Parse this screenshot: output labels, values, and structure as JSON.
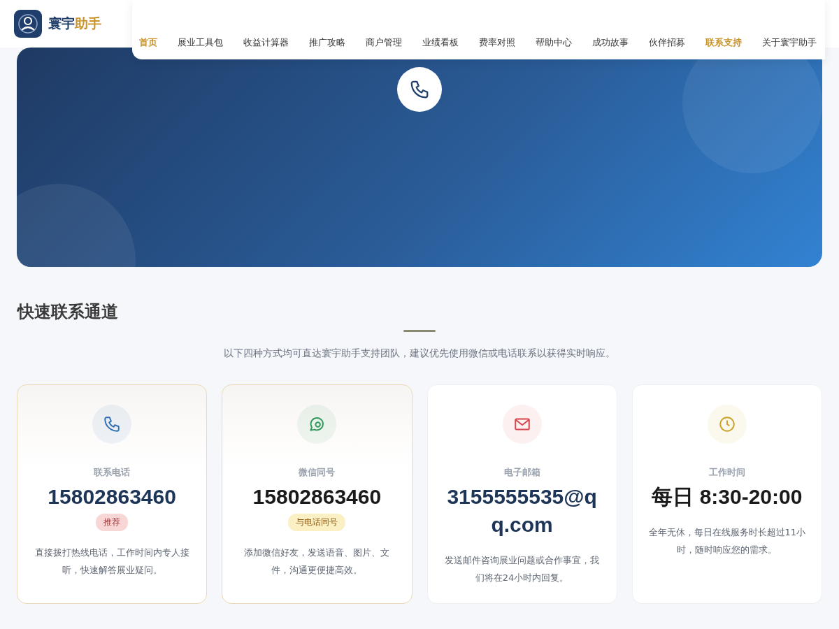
{
  "brand": {
    "name_part1": "寰宇",
    "name_part2": "助手"
  },
  "nav": [
    {
      "label": "首页",
      "selected": true
    },
    {
      "label": "展业工具包",
      "selected": false
    },
    {
      "label": "收益计算器",
      "selected": false
    },
    {
      "label": "推广攻略",
      "selected": false
    },
    {
      "label": "商户管理",
      "selected": false
    },
    {
      "label": "业绩看板",
      "selected": false
    },
    {
      "label": "费率对照",
      "selected": false
    },
    {
      "label": "帮助中心",
      "selected": false
    },
    {
      "label": "成功故事",
      "selected": false
    },
    {
      "label": "伙伴招募",
      "selected": false
    },
    {
      "label": "联系支持",
      "selected": true
    },
    {
      "label": "关于寰宇助手",
      "selected": false
    }
  ],
  "section": {
    "title": "快速联系通道",
    "subtitle": "以下四种方式均可直达寰宇助手支持团队，建议优先使用微信或电话联系以获得实时响应。"
  },
  "cards": [
    {
      "kind": "phone",
      "featured": true,
      "color": "#2f6fb5",
      "label": "联系电话",
      "value": "15802863460",
      "badge": {
        "kind": "recommend",
        "text": "推荐"
      },
      "description": "直接拨打热线电话，工作时间内专人接听，快速解答展业疑问。"
    },
    {
      "kind": "chat",
      "featured": true,
      "color": "#2e9a5a",
      "label": "微信同号",
      "value": "15802863460",
      "badge": {
        "kind": "same",
        "text": "与电话同号"
      },
      "description": "添加微信好友，发送语音、图片、文件，沟通更便捷高效。"
    },
    {
      "kind": "mail",
      "featured": false,
      "color": "#d9434b",
      "label": "电子邮箱",
      "value": "3155555535@qq.com",
      "description": "发送邮件咨询展业问题或合作事宜，我们将在24小时内回复。"
    },
    {
      "kind": "clock",
      "featured": false,
      "color": "#c9a227",
      "label": "工作时间",
      "value": "每日 8:30-20:00",
      "description": "全年无休，每日在线服务时长超过11小时，随时响应您的需求。"
    }
  ]
}
